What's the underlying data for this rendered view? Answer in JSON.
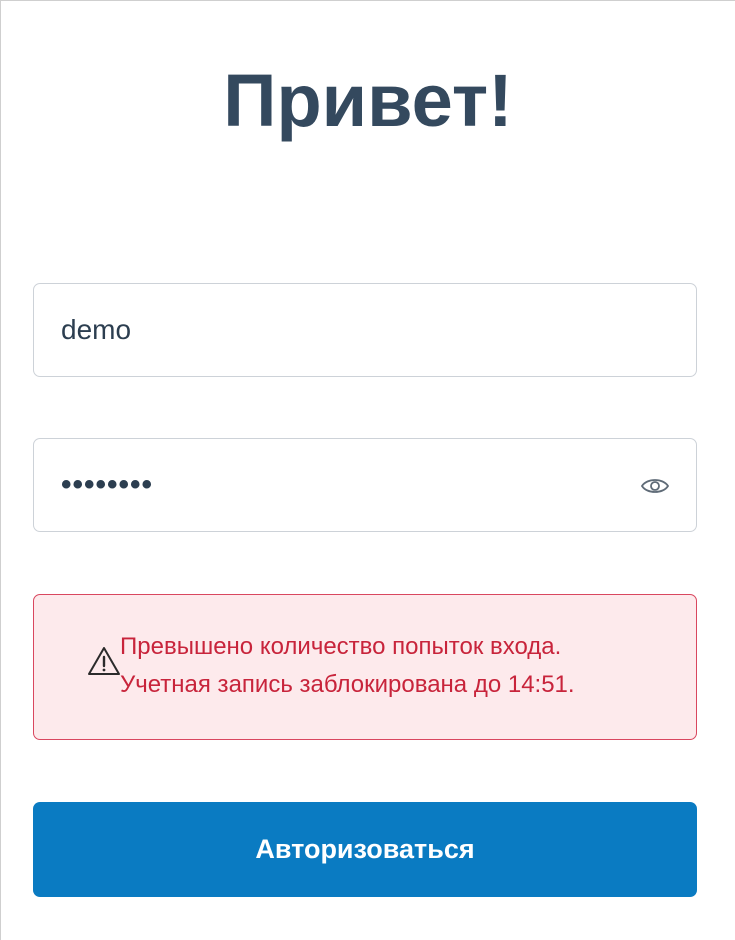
{
  "form": {
    "title": "Привет!",
    "login_value": "demo",
    "password_value": "••••••••",
    "password_toggle_icon": "eye-icon",
    "error": {
      "icon": "warning-icon",
      "line1": "Превышено количество попыток входа.",
      "line2": "Учетная запись заблокирована до 14:51."
    },
    "submit_label": "Авторизоваться"
  },
  "colors": {
    "title": "#34495e",
    "error_text": "#c8243b",
    "error_border": "#d9475f",
    "error_background": "#fdeaec",
    "button_background": "#0a7bc2",
    "button_text": "#ffffff"
  }
}
